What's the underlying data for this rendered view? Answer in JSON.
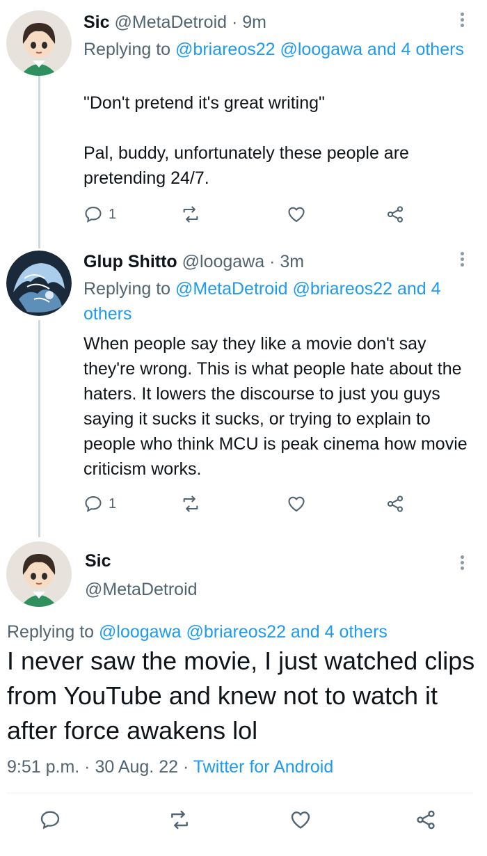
{
  "tweets": [
    {
      "name": "Sic",
      "handle": "@MetaDetroid",
      "time": "· 9m",
      "replying_prefix": "Replying to",
      "replying_mentions": "@briareos22 @loogawa and 4 others",
      "body": "\"Don't pretend it's great writing\"\n\nPal, buddy, unfortunately these people are pretending 24/7.",
      "reply_count": "1",
      "avatar_icon": "anime-girl-avatar"
    },
    {
      "name": "Glup Shitto",
      "handle": "@loogawa",
      "time": "· 3m",
      "replying_prefix": "Replying to",
      "replying_mentions": "@MetaDetroid @briareos22 and 4 others",
      "body": "When people say they like a movie don't say they're wrong. This is what people hate about the haters. It lowers the discourse to just you guys saying it sucks it sucks, or trying to explain to people who think MCU is peak cinema how movie criticism works.",
      "reply_count": "1",
      "avatar_icon": "blue-sketch-avatar"
    }
  ],
  "focus": {
    "name": "Sic",
    "handle": "@MetaDetroid",
    "replying_prefix": "Replying to",
    "replying_mentions": "@loogawa @briareos22 and 4 others",
    "body": "I never saw the movie, I just watched clips from YouTube and knew not to watch it after force awakens lol",
    "timestamp": "9:51 p.m. · 30 Aug. 22 ·",
    "source": "Twitter for Android"
  },
  "colors": {
    "accent": "#1d9bf0",
    "secondary_text": "#536471",
    "primary_text": "#0f1419",
    "thread_line": "#cfd9de"
  }
}
